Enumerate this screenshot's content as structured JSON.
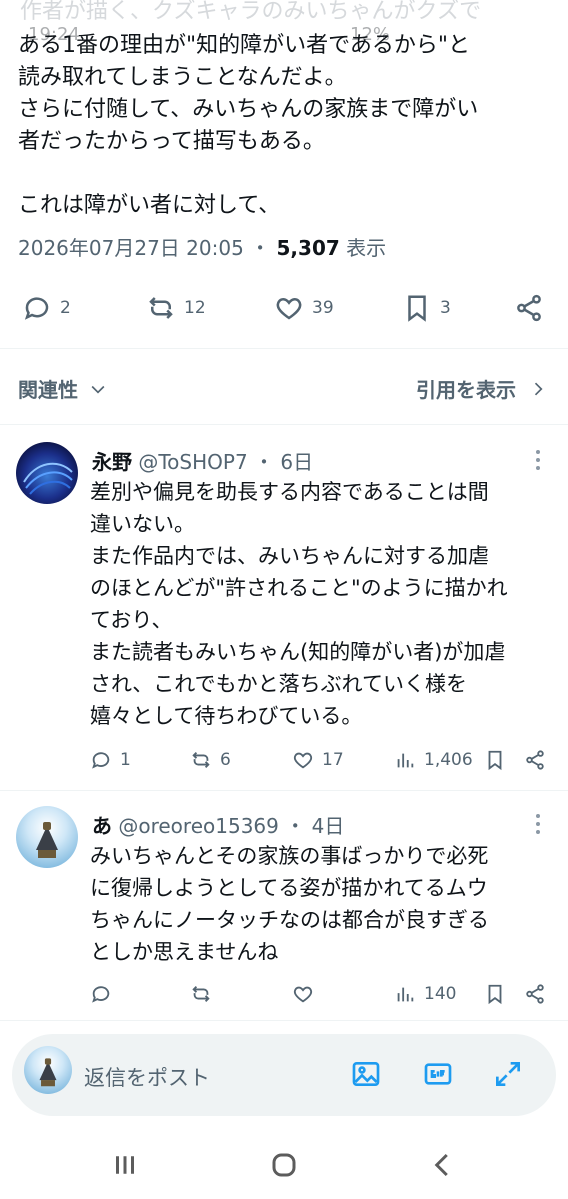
{
  "main_tweet": {
    "overlap_text": "作者が描く、クズキャラのみいちゃんがクズで",
    "status_time": "19:24",
    "status_battery": "12%",
    "text": "ある1番の理由が\"知的障がい者であるから\"と\n読み取れてしまうことなんだよ。\nさらに付随して、みいちゃんの家族まで障がい\n者だったからって描写もある。\n\nこれは障がい者に対して、",
    "timestamp": "2026年07月27日 20:05",
    "separator": "・",
    "views_count": "5,307",
    "views_label": "表示",
    "actions": {
      "reply_count": "2",
      "retweet_count": "12",
      "like_count": "39",
      "bookmark_count": "3"
    }
  },
  "related": {
    "label": "関連性",
    "quotes_label": "引用を表示"
  },
  "replies": [
    {
      "name": "永野",
      "handle": "@ToSHOP7",
      "time": "6日",
      "text": "差別や偏見を助長する内容であることは間\n違いない。\nまた作品内では、みいちゃんに対する加虐\nのほとんどが\"許されること\"のように描かれ\nており、\nまた読者もみいちゃん(知的障がい者)が加虐\nされ、これでもかと落ちぶれていく様を\n嬉々として待ちわびている。",
      "reply_count": "1",
      "retweet_count": "6",
      "like_count": "17",
      "view_count": "1,406"
    },
    {
      "name": "あ",
      "handle": "@oreoreo15369",
      "time": "4日",
      "text": "みいちゃんとその家族の事ばっかりで必死\nに復帰しようとしてる姿が描かれてるムウ\nちゃんにノータッチなのは都合が良すぎる\nとしか思えませんね",
      "reply_count": "",
      "retweet_count": "",
      "like_count": "",
      "view_count": "140"
    }
  ],
  "composer": {
    "placeholder": "返信をポスト"
  },
  "colors": {
    "accent": "#1d9bf0",
    "text": "#0f1419",
    "secondary": "#536471",
    "divider": "#eff3f4"
  },
  "icons": [
    "reply-icon",
    "retweet-icon",
    "like-icon",
    "bookmark-icon",
    "share-icon",
    "views-icon",
    "image-icon",
    "gif-icon",
    "expand-icon",
    "chevron-down-icon",
    "chevron-right-icon",
    "more-icon",
    "recents-icon",
    "home-icon",
    "back-icon"
  ]
}
